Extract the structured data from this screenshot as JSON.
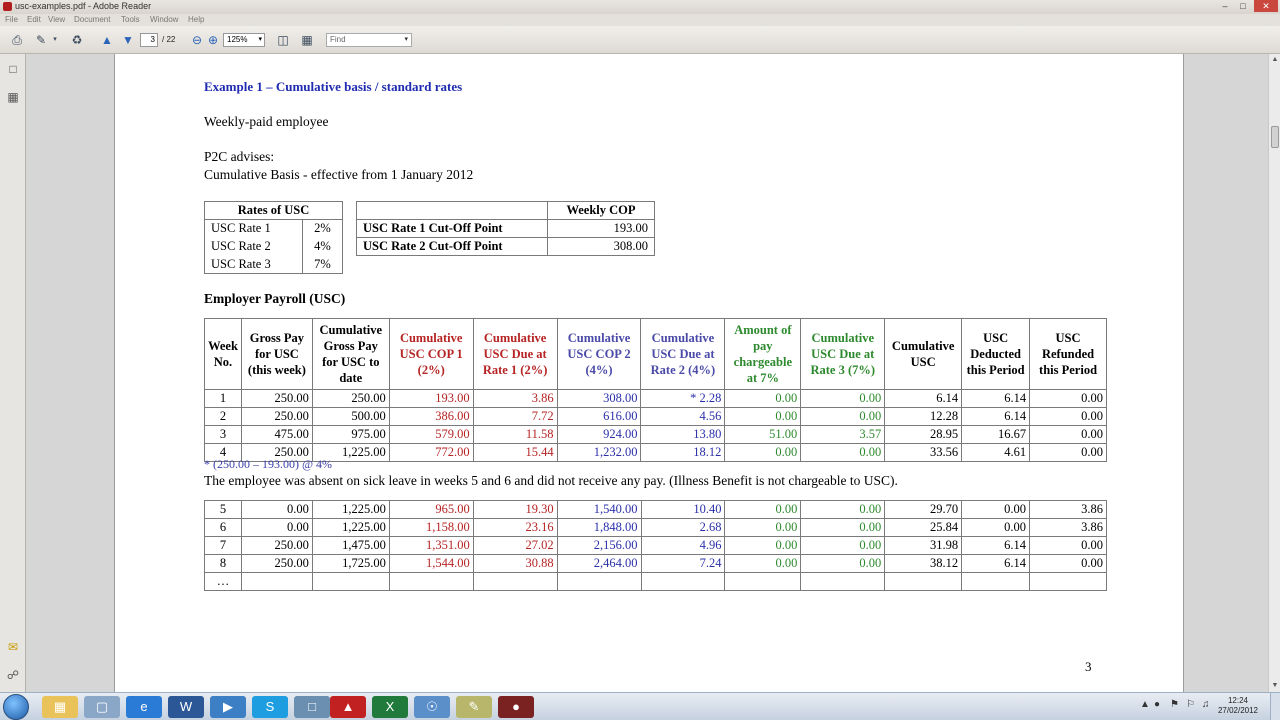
{
  "window": {
    "title": "usc-examples.pdf - Adobe Reader",
    "minimize": "–",
    "maximize": "□",
    "close": "✕"
  },
  "menu": [
    "File",
    "Edit",
    "View",
    "Document",
    "Tools",
    "Window",
    "Help"
  ],
  "toolbar": {
    "current_page": "3",
    "page_total": "/ 22",
    "zoom": "125%",
    "find_placeholder": "Find",
    "dropdown_glyph": "▾"
  },
  "document": {
    "heading": "Example 1 – Cumulative basis / standard rates",
    "employee_type": "Weekly-paid employee",
    "advises": "P2C advises:",
    "basis": "Cumulative Basis - effective from 1 January 2012",
    "rates_table": {
      "header": "Rates of USC",
      "rows": [
        {
          "label": "USC Rate 1",
          "value": "2%"
        },
        {
          "label": "USC Rate 2",
          "value": "4%"
        },
        {
          "label": "USC Rate 3",
          "value": "7%"
        }
      ]
    },
    "cop_table": {
      "header": "Weekly COP",
      "rows": [
        {
          "label": "USC Rate 1 Cut-Off Point",
          "value": "193.00"
        },
        {
          "label": "USC Rate 2 Cut-Off Point",
          "value": "308.00"
        }
      ]
    },
    "payroll_title": "Employer Payroll (USC)",
    "payroll_headers": [
      "Week No.",
      "Gross Pay for USC (this week)",
      "Cumulative Gross Pay for USC to date",
      "Cumulative USC COP 1 (2%)",
      "Cumulative USC Due at Rate 1 (2%)",
      "Cumulative USC COP 2 (4%)",
      "Cumulative USC Due at Rate 2 (4%)",
      "Amount of pay chargeable at 7%",
      "Cumulative USC Due at Rate 3 (7%)",
      "Cumulative USC",
      "USC Deducted this Period",
      "USC Refunded this Period"
    ],
    "payroll_rows_a": [
      [
        "1",
        "250.00",
        "250.00",
        "193.00",
        "3.86",
        "308.00",
        "* 2.28",
        "0.00",
        "0.00",
        "6.14",
        "6.14",
        "0.00"
      ],
      [
        "2",
        "250.00",
        "500.00",
        "386.00",
        "7.72",
        "616.00",
        "4.56",
        "0.00",
        "0.00",
        "12.28",
        "6.14",
        "0.00"
      ],
      [
        "3",
        "475.00",
        "975.00",
        "579.00",
        "11.58",
        "924.00",
        "13.80",
        "51.00",
        "3.57",
        "28.95",
        "16.67",
        "0.00"
      ],
      [
        "4",
        "250.00",
        "1,225.00",
        "772.00",
        "15.44",
        "1,232.00",
        "18.12",
        "0.00",
        "0.00",
        "33.56",
        "4.61",
        "0.00"
      ]
    ],
    "footnote": "* (250.00 – 193.00) @ 4%",
    "sick_note": "The employee was absent on sick leave in weeks 5 and 6 and did not receive any pay.  (Illness Benefit is not chargeable to USC).",
    "payroll_rows_b": [
      [
        "5",
        "0.00",
        "1,225.00",
        "965.00",
        "19.30",
        "1,540.00",
        "10.40",
        "0.00",
        "0.00",
        "29.70",
        "0.00",
        "3.86"
      ],
      [
        "6",
        "0.00",
        "1,225.00",
        "1,158.00",
        "23.16",
        "1,848.00",
        "2.68",
        "0.00",
        "0.00",
        "25.84",
        "0.00",
        "3.86"
      ],
      [
        "7",
        "250.00",
        "1,475.00",
        "1,351.00",
        "27.02",
        "2,156.00",
        "4.96",
        "0.00",
        "0.00",
        "31.98",
        "6.14",
        "0.00"
      ],
      [
        "8",
        "250.00",
        "1,725.00",
        "1,544.00",
        "30.88",
        "2,464.00",
        "7.24",
        "0.00",
        "0.00",
        "38.12",
        "6.14",
        "0.00"
      ],
      [
        "…",
        "",
        "",
        "",
        "",
        "",
        "",
        "",
        "",
        "",
        "",
        ""
      ]
    ],
    "page_number": "3"
  },
  "taskbar": {
    "time": "12:24",
    "date": "27/02/2012"
  },
  "colors": {
    "heading_blue": "#1f2bb0",
    "rate1_red": "#b62424",
    "rate2_blue": "#2b30a9",
    "rate3_green": "#2e8a2e"
  }
}
